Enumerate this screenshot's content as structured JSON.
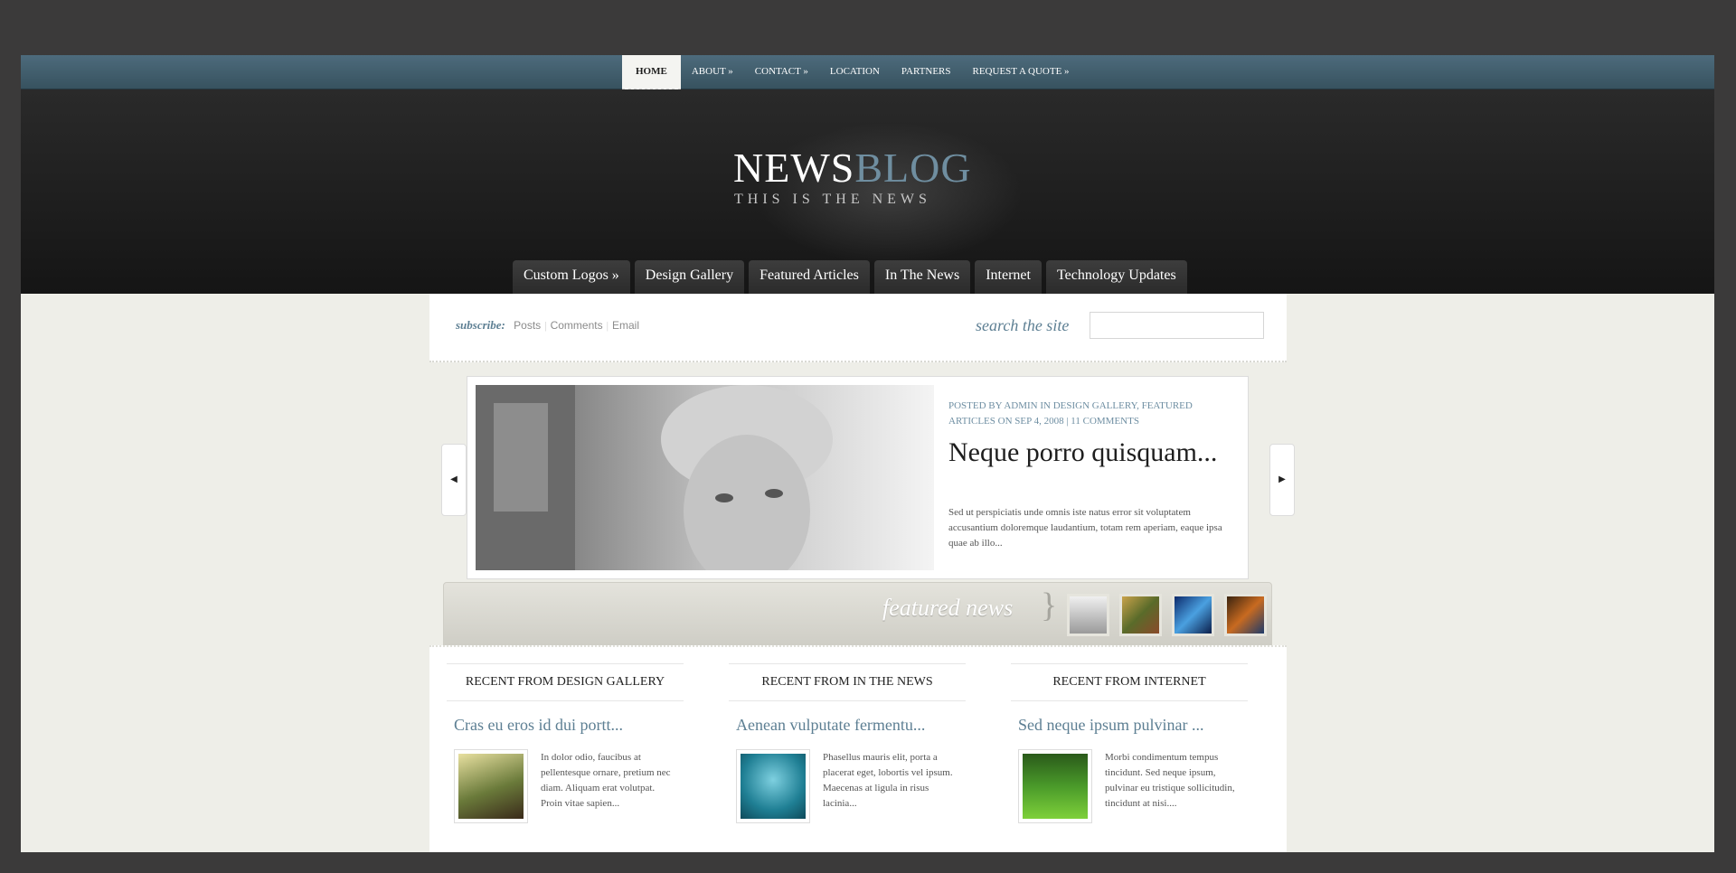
{
  "topnav": {
    "items": [
      {
        "label": "HOME"
      },
      {
        "label": "ABOUT »"
      },
      {
        "label": "CONTACT »"
      },
      {
        "label": "LOCATION"
      },
      {
        "label": "PARTNERS"
      },
      {
        "label": "REQUEST A QUOTE »"
      }
    ]
  },
  "header": {
    "logo_news": "NEWS",
    "logo_blog": "BLOG",
    "tagline": "THIS IS THE NEWS"
  },
  "catnav": {
    "items": [
      {
        "label": "Custom Logos »"
      },
      {
        "label": "Design Gallery"
      },
      {
        "label": "Featured Articles"
      },
      {
        "label": "In The News"
      },
      {
        "label": "Internet"
      },
      {
        "label": "Technology Updates"
      }
    ]
  },
  "subscribe": {
    "label": "subscribe:",
    "posts": "Posts",
    "comments": "Comments",
    "email": "Email"
  },
  "search": {
    "label": "search the site",
    "value": ""
  },
  "featured": {
    "meta": "POSTED BY ADMIN IN DESIGN GALLERY, FEATURED ARTICLES ON SEP 4, 2008 | 11 COMMENTS",
    "title": "Neque porro quisquam...",
    "excerpt": "Sed ut perspiciatis unde omnis iste natus error sit voluptatem accusantium doloremque laudantium, totam rem aperiam, eaque ipsa quae ab illo...",
    "strip_label": "featured news",
    "brace": "}"
  },
  "arrows": {
    "left": "◀",
    "right": "▶"
  },
  "recent": [
    {
      "heading": "RECENT FROM DESIGN GALLERY",
      "title": "Cras eu eros id dui portt...",
      "text": "In dolor odio, faucibus at pellentesque ornare, pretium nec diam. Aliquam erat volutpat. Proin vitae sapien..."
    },
    {
      "heading": "RECENT FROM IN THE NEWS",
      "title": "Aenean vulputate fermentu...",
      "text": "Phasellus mauris elit, porta a placerat eget, lobortis vel ipsum. Maecenas at ligula in risus lacinia..."
    },
    {
      "heading": "RECENT FROM INTERNET",
      "title": "Sed neque ipsum pulvinar ...",
      "text": "Morbi condimentum tempus tincidunt. Sed neque ipsum, pulvinar eu tristique sollicitudin, tincidunt at nisi...."
    }
  ],
  "colors": {
    "accent": "#5d7f93",
    "topnav": "#4d6b7c",
    "header": "#1c1c1c",
    "background": "#eeeee8"
  }
}
